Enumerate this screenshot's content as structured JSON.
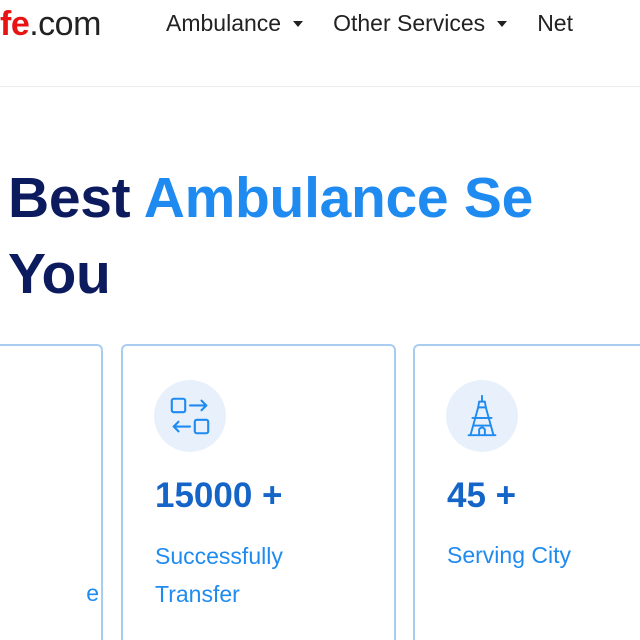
{
  "header": {
    "logo": {
      "accent": "fe",
      "domain": ".com"
    },
    "nav": [
      {
        "label": "Ambulance",
        "has_dropdown": true
      },
      {
        "label": "Other Services",
        "has_dropdown": true
      },
      {
        "label": "Net",
        "has_dropdown": false
      }
    ]
  },
  "hero": {
    "title_part1": "Best ",
    "title_accent": "Ambulance Se",
    "title_line2": "You"
  },
  "stats": [
    {
      "icon": "unknown-icon",
      "number": "",
      "label": "e"
    },
    {
      "icon": "transfer-icon",
      "number": "15000 +",
      "label": "Successfully Transfer"
    },
    {
      "icon": "city-tower-icon",
      "number": "45 +",
      "label": "Serving City"
    }
  ],
  "colors": {
    "brand_red": "#e81414",
    "navy": "#0c1a5e",
    "accent_blue": "#1f8bf0",
    "stat_blue": "#1565c8",
    "card_border": "#a9cdf1",
    "icon_bg": "#e8f1fb"
  }
}
